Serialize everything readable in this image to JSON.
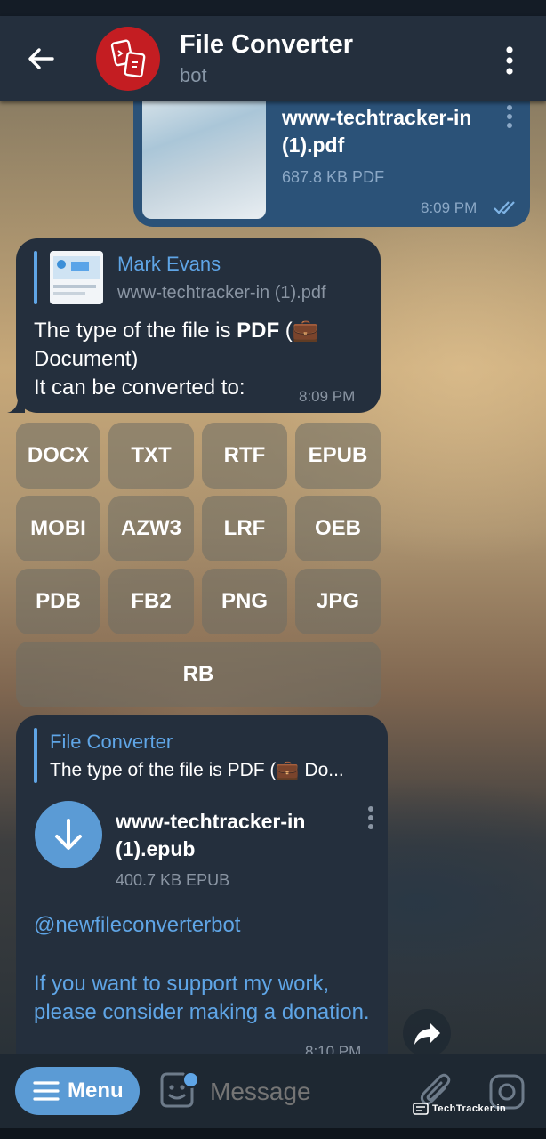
{
  "header": {
    "title": "File Converter",
    "subtitle": "bot"
  },
  "messages": {
    "sent_file": {
      "file_name": "www-techtracker-in (1).pdf",
      "file_meta": "687.8 KB PDF",
      "time": "8:09 PM"
    },
    "bot_reply": {
      "reply_author": "Mark Evans",
      "reply_text": "www-techtracker-in (1).pdf",
      "text_prefix": "The type of the file is ",
      "text_bold": "PDF",
      "text_suffix": " (💼 Document)",
      "text_line2": "It can be converted to:",
      "time": "8:09 PM"
    },
    "keyboard": {
      "buttons": [
        "DOCX",
        "TXT",
        "RTF",
        "EPUB",
        "MOBI",
        "AZW3",
        "LRF",
        "OEB",
        "PDB",
        "FB2",
        "PNG",
        "JPG",
        "RB"
      ]
    },
    "result": {
      "reply_author": "File Converter",
      "reply_text": "The type of the file is PDF (💼 Do...",
      "file_name": "www-techtracker-in (1).epub",
      "file_meta": "400.7 KB EPUB",
      "mention": "@newfileconverterbot",
      "donation_text": "If you want to support my work, please consider making a donation.",
      "time": "8:10 PM"
    }
  },
  "input_bar": {
    "menu_label": "Menu",
    "placeholder": "Message"
  },
  "watermark": "TechTracker.in",
  "colors": {
    "header_bg": "#242f3d",
    "incoming_bubble": "#242f3d",
    "outgoing_bubble": "#2b5278",
    "accent_blue": "#5fa5e6",
    "menu_button": "#5b9bd5",
    "avatar_red": "#c41d22"
  },
  "icons": {
    "back": "arrow-left-icon",
    "more": "more-vertical-icon",
    "download": "download-icon",
    "forward": "share-forward-icon",
    "read_status": "double-check-icon",
    "sticker": "sticker-icon",
    "attach": "paperclip-icon",
    "camera": "instagram-camera-icon"
  }
}
